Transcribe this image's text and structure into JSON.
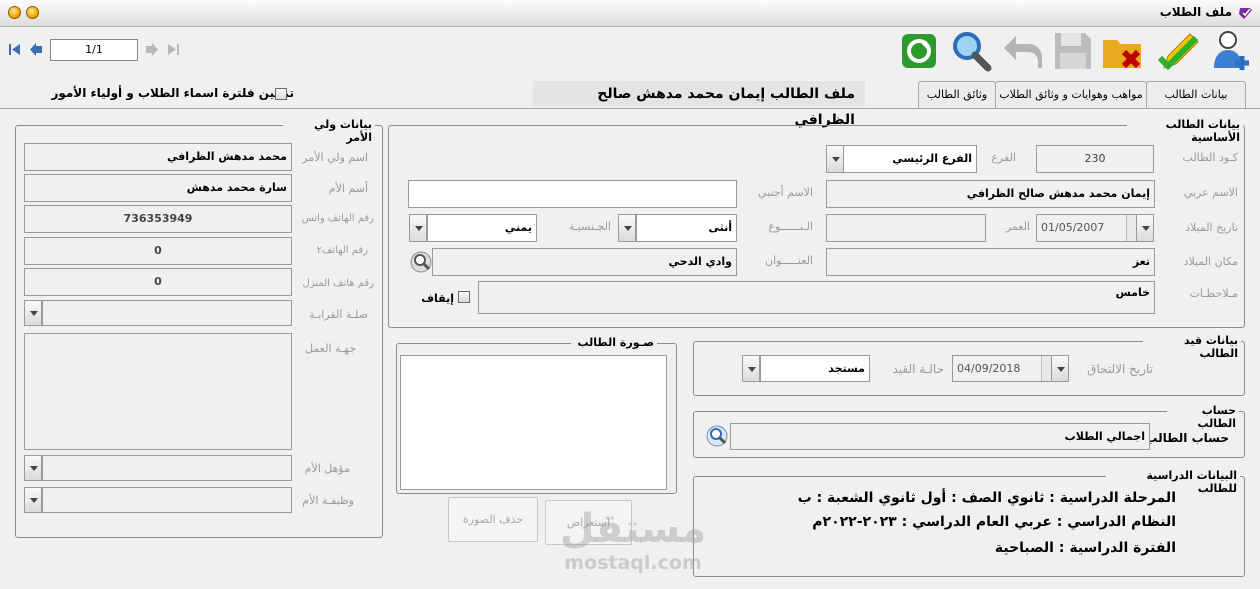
{
  "window": {
    "title": "ملف الطلاب"
  },
  "nav": {
    "position": "1/1"
  },
  "tabs": [
    "بيانات الطالب",
    "مواهب وهوايات و وثائق الطلاب",
    "وثائق الطالب"
  ],
  "header": {
    "student_file": "ملف الطالب  إيمان محمد مدهش صالح الظرافي",
    "filter_label": "تمكين فلترة اسماء الطلاب و أولياء الأمور"
  },
  "basic": {
    "title": "بيانات الطالب الأساسية",
    "code_label": "كـود الطالب",
    "code": "230",
    "branch_label": "الفرع",
    "branch": "الفرع الرئيسي",
    "arabic_name_label": "الاسم عربي",
    "arabic_name": "إيمان محمد مدهش صالح الظرافي",
    "foreign_name_label": "الاسم أجنبي",
    "foreign_name": "",
    "birth_date_label": "تاريخ الميلاد",
    "birth_date": "01/05/2007",
    "age_label": "العمر",
    "age": "",
    "gender_label": "الـنــــــوع",
    "gender": "أنثى",
    "nationality_label": "الجـنسيـة",
    "nationality": "يمني",
    "birth_place_label": "مكان الميلاد",
    "birth_place": "تعز",
    "address_label": "العنـــــوان",
    "address": "وادي الدحي",
    "notes_label": "مـلاحظـات",
    "notes": "خامس",
    "stop_label": "إيقاف"
  },
  "guardian": {
    "title": "بيانات ولي الأمر",
    "name_label": "اسم ولي الأمر",
    "name": "محمد مدهش الظرافي",
    "mother_label": "أسم الأم",
    "mother": "سارة محمد مدهش",
    "whatsapp_label": "رقم الهاتف واتس",
    "whatsapp": "736353949",
    "phone2_label": "رقم الهاتف٢",
    "phone2": "0",
    "home_label": "رقم هاتف المنزل",
    "home": "0",
    "relation_label": "صلـة القرابـة",
    "work_label": "جهـة العمل",
    "mother_qual_label": "مؤهل الأم",
    "mother_job_label": "وظيفـة الأم"
  },
  "photo": {
    "title": "صـورة الطالب",
    "delete": "حذف الصورة",
    "browse": "إستعراض"
  },
  "registration": {
    "title": "بيانات قيد الطالب",
    "join_date_label": "تاريخ الالتحاق",
    "join_date": "04/09/2018",
    "status_label": "حالـة القيد",
    "status": "مستجد"
  },
  "account": {
    "title": "حساب الطالب",
    "label": "حساب الطالب",
    "value": "اجمالي الطلاب"
  },
  "study": {
    "title": "البيانات الدراسية للطالب",
    "line1": "المرحلة الدراسية  :   ثانوي   الصف :  أول ثانوي    الشعبة  :   ب",
    "line2": "النظام الدراسي  :   عربي   العام الدراسي  :   ٢٠٢٣-٢٠٢٢م",
    "line3": "الفترة الدراسية  :    الصباحية"
  },
  "watermark": {
    "arabic": "مستقل",
    "latin": "mostaql.com"
  },
  "icons": [
    "add-user-icon",
    "edit-icon",
    "delete-icon",
    "save-icon",
    "undo-icon",
    "search-icon",
    "refresh-icon"
  ]
}
